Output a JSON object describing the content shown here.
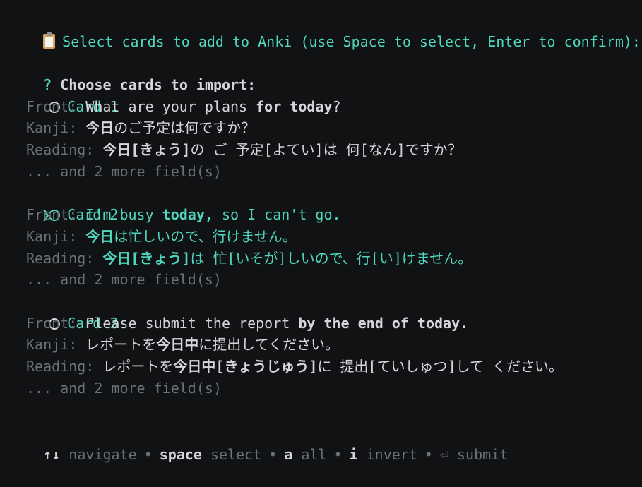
{
  "header": {
    "title": "Select cards to add to Anki (use Space to select, Enter to confirm):"
  },
  "prompt": {
    "marker": "?",
    "question": "Choose cards to import:"
  },
  "cursor_glyph": "❯",
  "labels": {
    "front": "Front:",
    "kanji": "Kanji:",
    "reading": "Reading:"
  },
  "cards": [
    {
      "title": "Card 1",
      "front": [
        {
          "t": "What are your plans "
        },
        {
          "t": "for today",
          "b": true
        },
        {
          "t": "?"
        }
      ],
      "kanji": [
        {
          "t": "今日",
          "b": true
        },
        {
          "t": "のご予定は何ですか？"
        }
      ],
      "reading": [
        {
          "t": "今日[きょう]",
          "b": true
        },
        {
          "t": "の ご 予定[よてい]は 何[なん]ですか？"
        }
      ],
      "more": "... and 2 more field(s)"
    },
    {
      "title": "Card 2",
      "front": [
        {
          "t": "I'm busy "
        },
        {
          "t": "today,",
          "b": true
        },
        {
          "t": " so I can't go."
        }
      ],
      "kanji": [
        {
          "t": "今日",
          "b": true
        },
        {
          "t": "は忙しいので、行けません。"
        }
      ],
      "reading": [
        {
          "t": "今日[きょう]",
          "b": true
        },
        {
          "t": "は 忙[いそが]しいので、行[い]けません。"
        }
      ],
      "more": "... and 2 more field(s)"
    },
    {
      "title": "Card 3",
      "front": [
        {
          "t": "Please submit the report "
        },
        {
          "t": "by the end of today.",
          "b": true
        }
      ],
      "kanji": [
        {
          "t": "レポートを"
        },
        {
          "t": "今日中",
          "b": true
        },
        {
          "t": "に提出してください。"
        }
      ],
      "reading": [
        {
          "t": "レポートを"
        },
        {
          "t": "今日中[きょうじゅう]",
          "b": true
        },
        {
          "t": "に 提出[ていしゅつ]して ください。"
        }
      ],
      "more": "... and 2 more field(s)"
    }
  ],
  "footer": {
    "navigate_key": "↑↓",
    "navigate_label": "navigate",
    "select_key": "space",
    "select_label": "select",
    "all_key": "a",
    "all_label": "all",
    "invert_key": "i",
    "invert_label": "invert",
    "submit_key": "⏎",
    "submit_label": "submit",
    "separator": "•"
  },
  "colors": {
    "accent": "#4fd6be",
    "muted": "#6b7079",
    "text": "#d4d6d9",
    "background": "#111214"
  }
}
